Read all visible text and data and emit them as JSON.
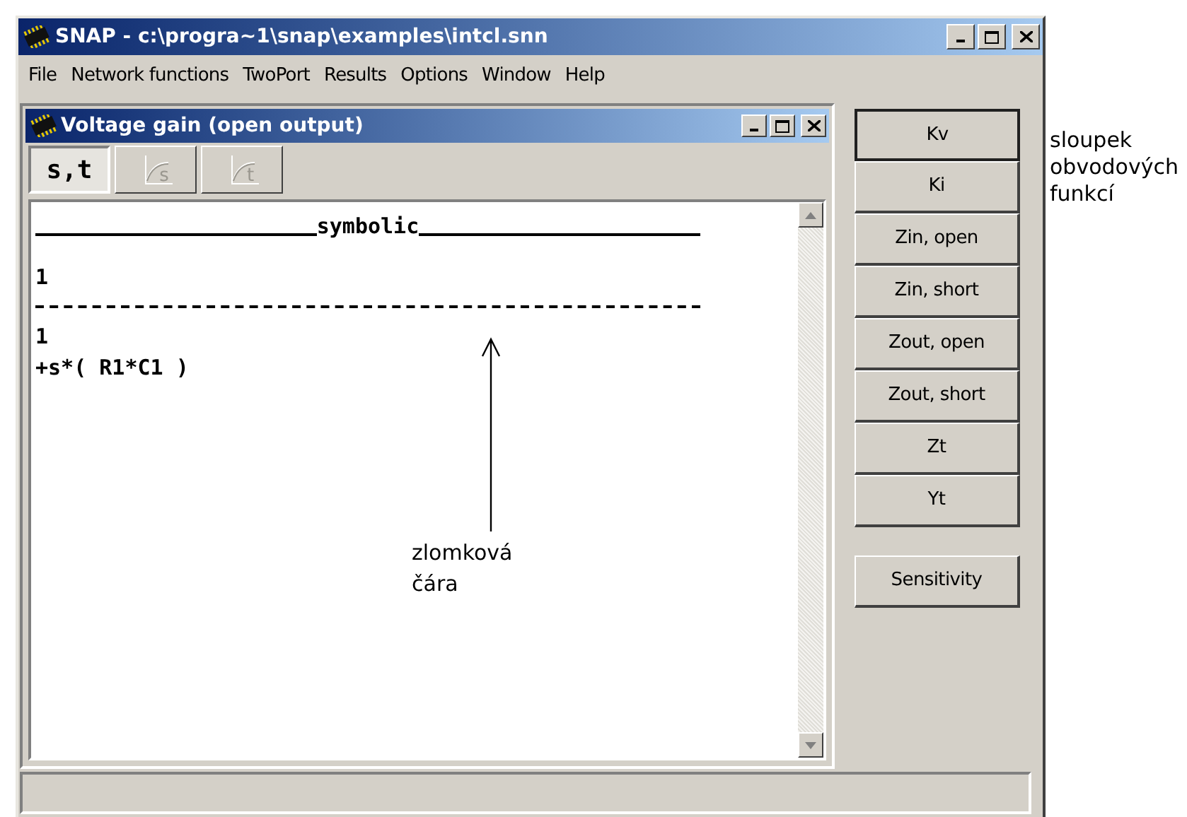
{
  "window": {
    "title": "SNAP - c:\\progra~1\\snap\\examples\\intcl.snn"
  },
  "menu": [
    "File",
    "Network functions",
    "TwoPort",
    "Results",
    "Options",
    "Window",
    "Help"
  ],
  "child_window": {
    "title": "Voltage gain (open output)",
    "tabs": [
      {
        "kind": "text",
        "label": "s,t",
        "selected": true,
        "disabled": false
      },
      {
        "kind": "plot",
        "label": "s",
        "selected": false,
        "disabled": true
      },
      {
        "kind": "plot",
        "label": "t",
        "selected": false,
        "disabled": true
      }
    ],
    "result": {
      "heading": "symbolic",
      "numerator": [
        "1"
      ],
      "denominator": [
        "1",
        "+s*( R1*C1 )"
      ]
    }
  },
  "function_buttons": [
    {
      "label": "Kv",
      "selected": true
    },
    {
      "label": "Ki",
      "selected": false
    },
    {
      "label": "Zin, open",
      "selected": false
    },
    {
      "label": "Zin, short",
      "selected": false
    },
    {
      "label": "Zout, open",
      "selected": false
    },
    {
      "label": "Zout, short",
      "selected": false
    },
    {
      "label": "Zt",
      "selected": false
    },
    {
      "label": "Yt",
      "selected": false
    }
  ],
  "sensitivity_button": "Sensitivity",
  "annotations": [
    {
      "kind": "column",
      "text": [
        "sloupek",
        "obvodových",
        "funkcí"
      ]
    },
    {
      "kind": "fraction",
      "text": [
        "zlomková",
        "čára"
      ]
    }
  ]
}
